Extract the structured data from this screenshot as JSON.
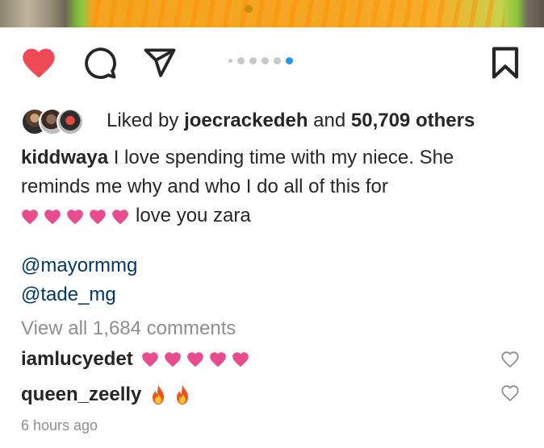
{
  "post": {
    "likes": {
      "prefix": "Liked by",
      "user": "joecrackedeh",
      "conjunction": "and",
      "others": "50,709 others"
    },
    "caption": {
      "username": "kiddwaya",
      "text": "I love spending time with my niece. She reminds me why and who I do all of this for",
      "suffix": "love you zara",
      "mentions": [
        "@mayormmg",
        "@tade_mg"
      ]
    },
    "view_all_comments": "View all 1,684 comments",
    "comments": [
      {
        "username": "iamlucyedet",
        "emoji": "pink-heart",
        "emoji_count": 5
      },
      {
        "username": "queen_zeelly",
        "emoji": "fire",
        "emoji_count": 2
      }
    ],
    "timestamp": "6 hours ago",
    "carousel": {
      "total": 6,
      "active_index": 5
    },
    "liked": true
  },
  "colors": {
    "like_red": "#ed4956",
    "carousel_active": "#2196f3",
    "mention_blue": "#00376b",
    "muted_gray": "#8e8e8e",
    "pink_heart": "#e94b8f"
  },
  "icons": {
    "like": "heart-filled-icon",
    "comment": "speech-bubble-icon",
    "share": "paper-plane-icon",
    "save": "bookmark-icon",
    "comment_like": "heart-outline-icon"
  }
}
